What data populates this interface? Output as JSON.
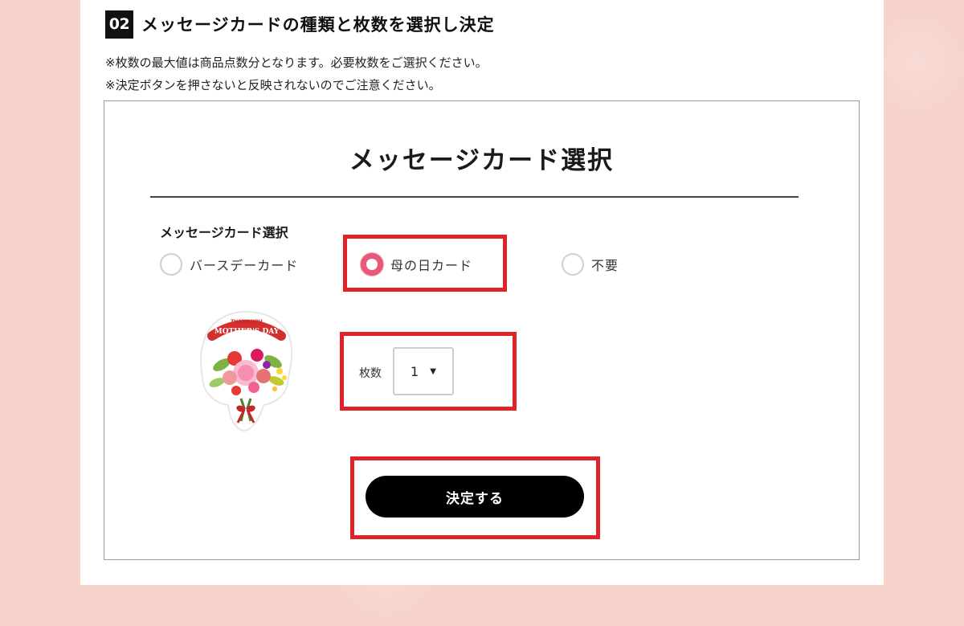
{
  "step": {
    "number": "02",
    "title": "メッセージカードの種類と枚数を選択し決定"
  },
  "notes": [
    "※枚数の最大値は商品点数分となります。必要枚数をご選択ください。",
    "※決定ボタンを押さないと反映されないのでご注意ください。"
  ],
  "dialog": {
    "title": "メッセージカード選択",
    "field_label": "メッセージカード選択",
    "options": [
      {
        "label": "バースデーカード",
        "selected": false
      },
      {
        "label": "母の日カード",
        "selected": true
      },
      {
        "label": "不要",
        "selected": false
      }
    ],
    "card_image_text": {
      "line1": "THANK YOU",
      "line2": "MOTHER'S DAY"
    },
    "quantity": {
      "label": "枚数",
      "value": "1"
    },
    "decide_button": "決定する"
  },
  "colors": {
    "background": "#f6d3cb",
    "highlight": "#e0222a",
    "radio_selected": "#e8587a",
    "button": "#000000"
  }
}
